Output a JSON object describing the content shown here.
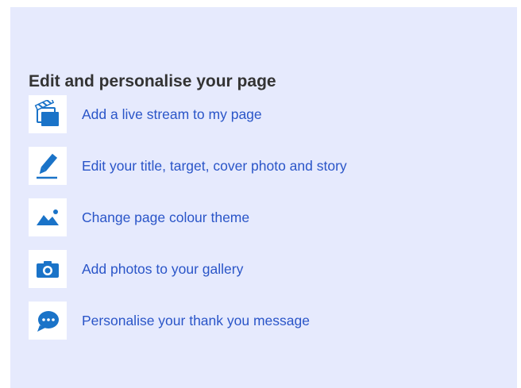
{
  "section": {
    "title": "Edit and personalise your page",
    "items": [
      {
        "label": "Add a live stream to my page",
        "icon": "clapperboard-icon"
      },
      {
        "label": "Edit your title, target, cover photo and story",
        "icon": "pencil-icon"
      },
      {
        "label": "Change page colour theme",
        "icon": "landscape-image-icon"
      },
      {
        "label": "Add photos to your gallery",
        "icon": "camera-icon"
      },
      {
        "label": "Personalise your thank you message",
        "icon": "speech-bubble-icon"
      }
    ]
  },
  "colors": {
    "panel_background": "#e6eafd",
    "link_text": "#2a55c8",
    "icon_blue": "#1a73c8",
    "heading_text": "#333333"
  }
}
